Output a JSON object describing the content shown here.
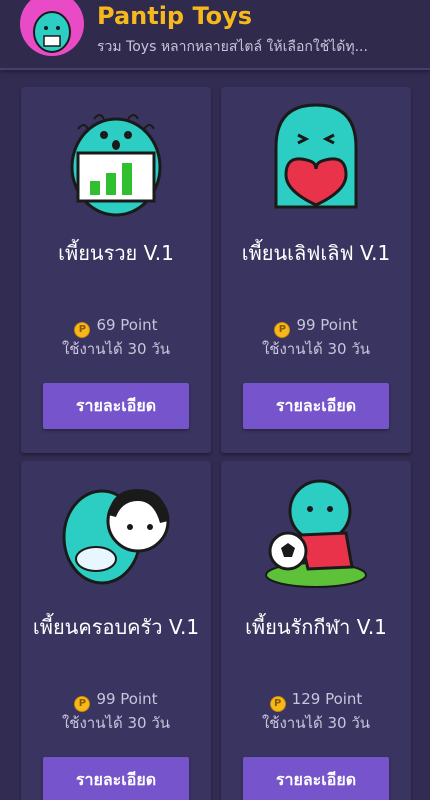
{
  "header": {
    "title": "Pantip Toys",
    "subtitle": "รวม Toys หลากหลายสไตล์ ให้เลือกใช้ได้ทุ..."
  },
  "cards": [
    {
      "name": "เพี้ยนรวย V.1",
      "price": "69 Point",
      "duration": "ใช้งานได้ 30 วัน",
      "button": "รายละเอียด",
      "icon": "rich-character-icon"
    },
    {
      "name": "เพี้ยนเลิฟเลิฟ V.1",
      "price": "99 Point",
      "duration": "ใช้งานได้ 30 วัน",
      "button": "รายละเอียด",
      "icon": "love-character-icon"
    },
    {
      "name": "เพี้ยนครอบครัว V.1",
      "price": "99 Point",
      "duration": "ใช้งานได้ 30 วัน",
      "button": "รายละเอียด",
      "icon": "family-character-icon"
    },
    {
      "name": "เพี้ยนรักกีฬา V.1",
      "price": "129 Point",
      "duration": "ใช้งานได้ 30 วัน",
      "button": "รายละเอียด",
      "icon": "sport-character-icon"
    }
  ],
  "colors": {
    "background": "#332c52",
    "card": "#3a3460",
    "accent_button": "#7554cc",
    "title": "#f7b81e",
    "character": "#2ccdc2",
    "coin": "#f6b81a"
  }
}
